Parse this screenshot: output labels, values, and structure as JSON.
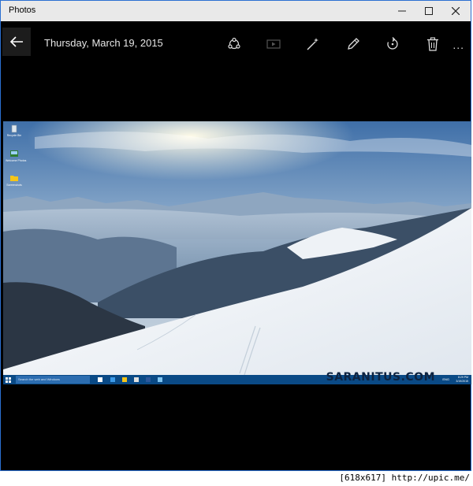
{
  "window": {
    "title": "Photos"
  },
  "toolbar": {
    "date": "Thursday, March 19, 2015",
    "more": "..."
  },
  "desktop": {
    "icons": [
      {
        "label": "Recycle Bin",
        "icon": "recycle-bin-icon"
      },
      {
        "label": "Welcome Photos",
        "icon": "photos-icon"
      },
      {
        "label": "Screenshots",
        "icon": "folder-icon"
      }
    ],
    "watermark": "SARANITUS.COM",
    "taskbar": {
      "search_placeholder": "Search the web and Windows",
      "lang": "ENG",
      "time": "8:29 PM",
      "date": "3/19/2015"
    }
  },
  "footer": "[618x617] http://upic.me/"
}
